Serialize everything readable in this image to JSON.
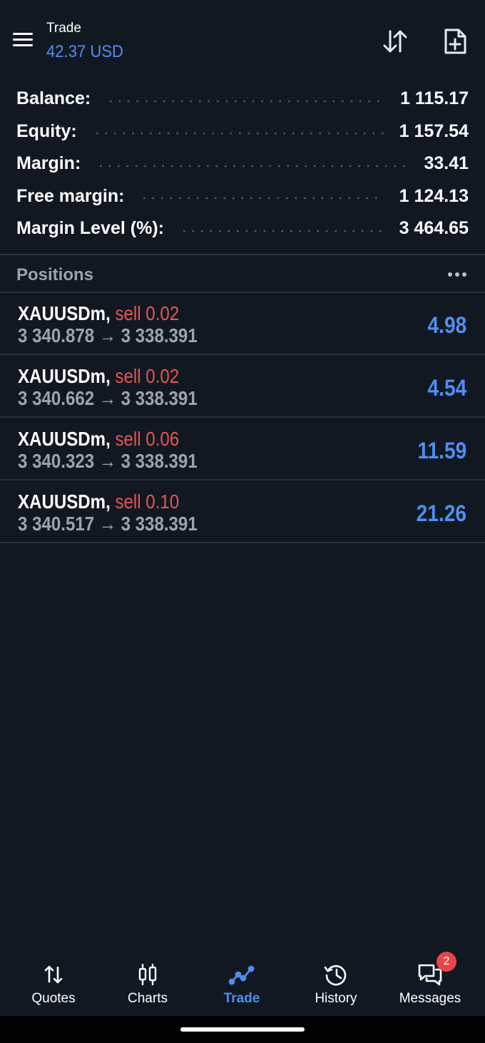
{
  "header": {
    "title": "Trade",
    "profit": "42.37 USD"
  },
  "summary": [
    {
      "label": "Balance:",
      "value": "1 115.17"
    },
    {
      "label": "Equity:",
      "value": "1 157.54"
    },
    {
      "label": "Margin:",
      "value": "33.41"
    },
    {
      "label": "Free margin:",
      "value": "1 124.13"
    },
    {
      "label": "Margin Level (%):",
      "value": "3 464.65"
    }
  ],
  "positions_header": {
    "title": "Positions"
  },
  "positions": [
    {
      "symbol": "XAUUSDm,",
      "side": "sell 0.02",
      "prices": "3 340.878 → 3 338.391",
      "profit": "4.98"
    },
    {
      "symbol": "XAUUSDm,",
      "side": "sell 0.02",
      "prices": "3 340.662 → 3 338.391",
      "profit": "4.54"
    },
    {
      "symbol": "XAUUSDm,",
      "side": "sell 0.06",
      "prices": "3 340.323 → 3 338.391",
      "profit": "11.59"
    },
    {
      "symbol": "XAUUSDm,",
      "side": "sell 0.10",
      "prices": "3 340.517 → 3 338.391",
      "profit": "21.26"
    }
  ],
  "nav": {
    "items": [
      {
        "label": "Quotes",
        "icon": "quotes-icon"
      },
      {
        "label": "Charts",
        "icon": "charts-icon"
      },
      {
        "label": "Trade",
        "icon": "trade-icon",
        "active": true
      },
      {
        "label": "History",
        "icon": "history-icon"
      },
      {
        "label": "Messages",
        "icon": "messages-icon"
      }
    ],
    "messages_badge": "2"
  },
  "colors": {
    "background": "#121822",
    "accent": "#4f8ef0",
    "sell": "#e5564f",
    "muted": "#9aa3ae",
    "badge": "#e5454a"
  }
}
